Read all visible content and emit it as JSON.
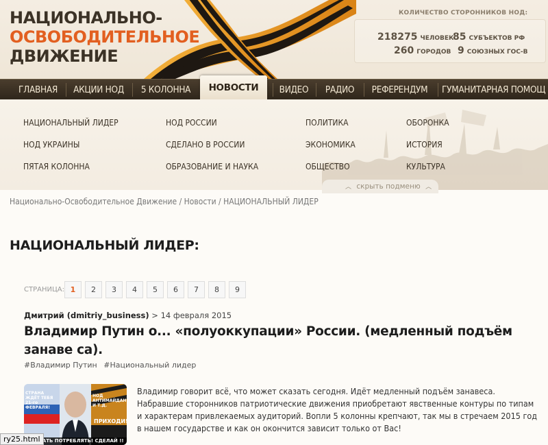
{
  "logo": {
    "line1": "НАЦИОНАЛЬНО-",
    "line2": "ОСВОБОДИТЕЛЬНОЕ",
    "line3": "ДВИЖЕНИЕ"
  },
  "stats": {
    "title": "КОЛИЧЕСТВО СТОРОННИКОВ НОД:",
    "people_num": "218275",
    "people_unit": "ЧЕЛОВЕК",
    "subjects_num": "85",
    "subjects_unit": "СУБЪЕКТОВ РФ",
    "cities_num": "260",
    "cities_unit": "ГОРОДОВ",
    "allies_num": "9",
    "allies_unit": "СОЮЗНЫХ ГОС-В"
  },
  "nav": {
    "items": [
      "ГЛАВНАЯ",
      "АКЦИИ НОД",
      "5 КОЛОННА",
      "НОВОСТИ",
      "ВИДЕО",
      "РАДИО",
      "РЕФЕРЕНДУМ",
      "ГУМАНИТАРНАЯ ПОМОЩ"
    ],
    "active": "НОВОСТИ"
  },
  "submenu": {
    "col1": [
      "НАЦИОНАЛЬНЫЙ ЛИДЕР",
      "НОД УКРАИНЫ",
      "ПЯТАЯ КОЛОННА"
    ],
    "col2": [
      "НОД РОССИИ",
      "СДЕЛАНО В РОССИИ",
      "ОБРАЗОВАНИЕ И НАУКА"
    ],
    "col3": [
      "ПОЛИТИКА",
      "ЭКОНОМИКА",
      "ОБЩЕСТВО"
    ],
    "col4": [
      "ОБОРОНКА",
      "ИСТОРИЯ",
      "КУЛЬТУРА"
    ],
    "hide_label": "скрыть подменю"
  },
  "breadcrumb": "Национально-Освободительное Движение / Новости / НАЦИОНАЛЬНЫЙ ЛИДЕР",
  "page_title": "НАЦИОНАЛЬНЫЙ ЛИДЕР:",
  "pagination": {
    "label": "СТРАНИЦА:",
    "pages": [
      "1",
      "2",
      "3",
      "4",
      "5",
      "6",
      "7",
      "8",
      "9"
    ],
    "current": "1"
  },
  "article": {
    "author": "Дмитрий (dmitriy_business)",
    "date": "> 14 февраля 2015",
    "title": "Владимир Путин о... «полуоккупации» России. (медленный подъём занаве са).",
    "tags": [
      "#Владимир Путин",
      "#Национальный лидер"
    ],
    "text": "Владимир говорит всё, что может сказать сегодня. Идёт медленный подъём занавеса. Набравшие сторонников патриотические движения приобретают явственные контуры по типам и характерам привлекаемых аудиторий. Вопли 5 колонны крепчают, так мы в стречаем 2015 год в нашем государстве и как он окончится зависит только от Вас!",
    "thumb_text": {
      "left": "СТРАНА ЖДЁТ ТЕБЯ 21-го ФЕВРАЛЯ!",
      "right": "НОД АНТИМАЙДАН И Т.Д.",
      "come": "ПРИХОДИ!",
      "bottom": "ТАТЬ ПОТРЕБЛЯТЬ! СДЕЛАЙ !!"
    }
  },
  "status_url": "ry25.html",
  "colors": {
    "accent": "#e25f20",
    "nav_bg": "#3a2f22",
    "header_bg": "#f2eadd"
  }
}
